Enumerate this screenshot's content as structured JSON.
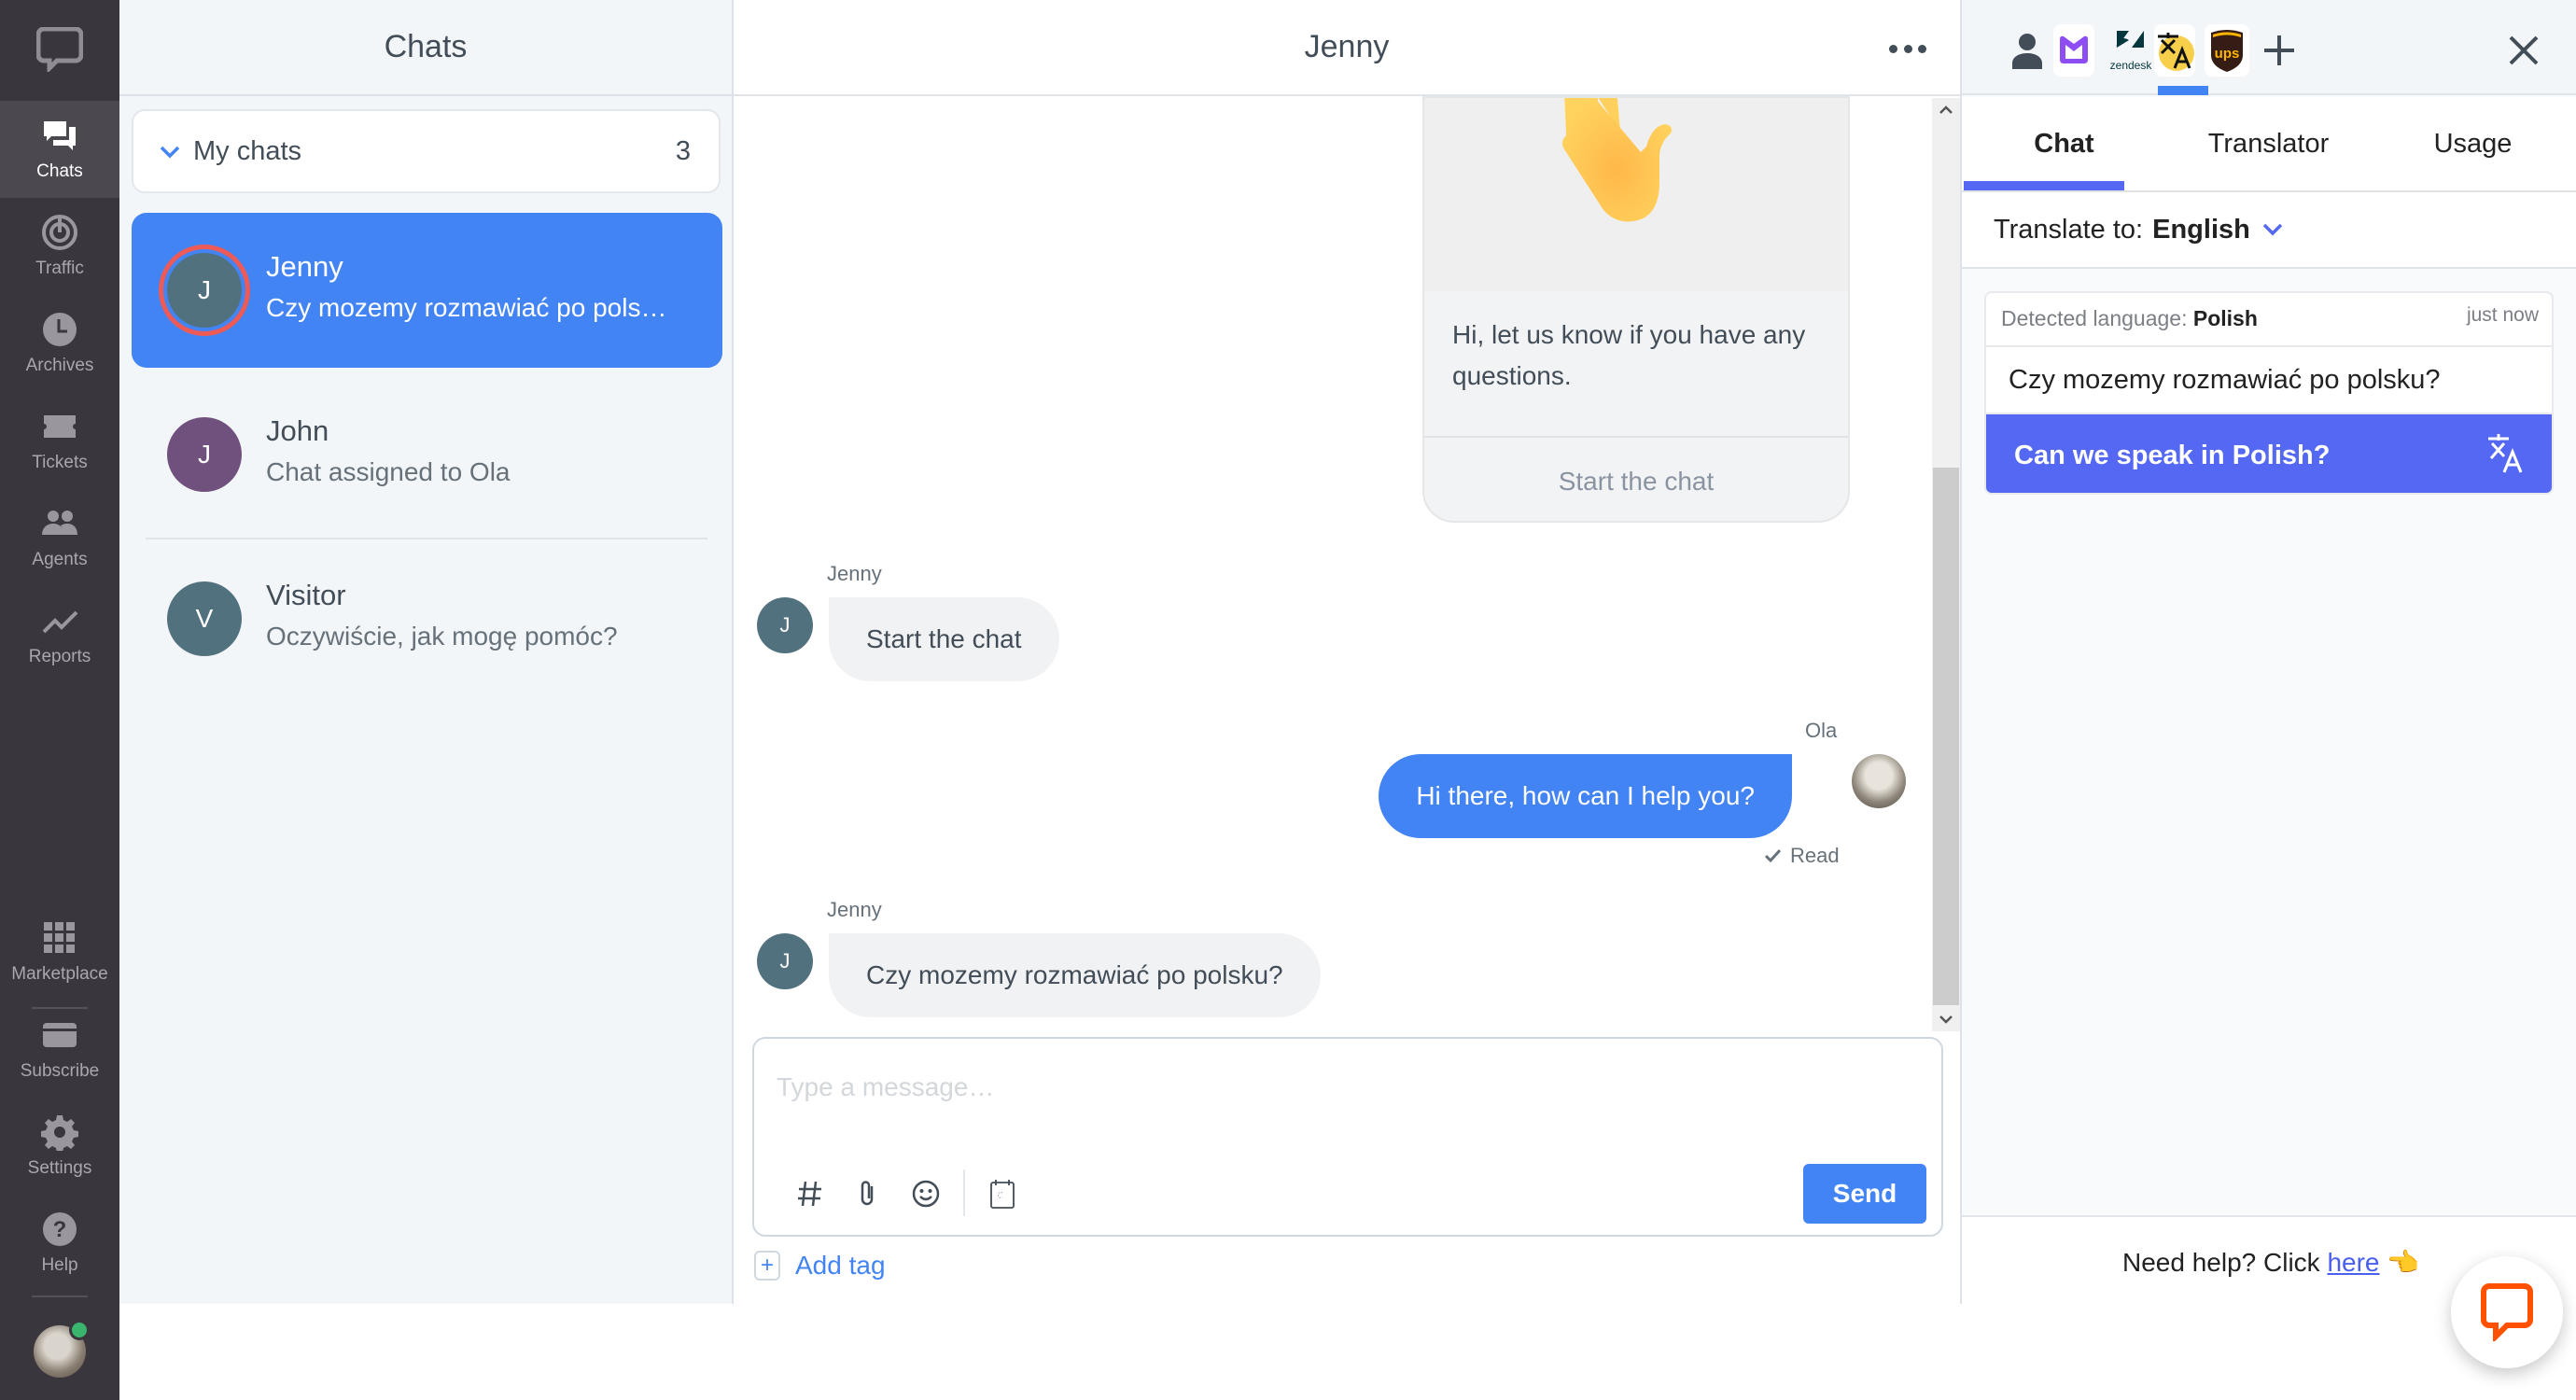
{
  "nav": {
    "logo_icon": "livechat-logo-icon",
    "items": [
      {
        "label": "Chats",
        "icon": "chats-icon",
        "active": true
      },
      {
        "label": "Traffic",
        "icon": "traffic-icon"
      },
      {
        "label": "Archives",
        "icon": "clock-icon"
      },
      {
        "label": "Tickets",
        "icon": "ticket-icon"
      },
      {
        "label": "Agents",
        "icon": "agents-icon"
      },
      {
        "label": "Reports",
        "icon": "chart-line-icon"
      }
    ],
    "bottom_items": [
      {
        "label": "Marketplace",
        "icon": "grid-icon"
      },
      {
        "label": "Subscribe",
        "icon": "credit-card-icon"
      },
      {
        "label": "Settings",
        "icon": "gear-icon"
      },
      {
        "label": "Help",
        "icon": "help-icon"
      }
    ],
    "status_color": "#3ab56e"
  },
  "chats": {
    "title": "Chats",
    "group": {
      "label": "My chats",
      "count": "3"
    },
    "items": [
      {
        "initial": "J",
        "name": "Jenny",
        "preview": "Czy mozemy rozmawiać po polsku?",
        "avatar_color": "#52717e",
        "active": true
      },
      {
        "initial": "J",
        "name": "John",
        "preview": "Chat assigned to Ola",
        "avatar_color": "#70507c"
      },
      {
        "initial": "V",
        "name": "Visitor",
        "preview": "Oczywiście, jak mogę pomóc?",
        "avatar_color": "#52717e"
      }
    ]
  },
  "conversation": {
    "title": "Jenny",
    "greeting_card": {
      "emoji": "👋",
      "text": "Hi, let us know if you have any questions.",
      "button": "Start the chat"
    },
    "messages": [
      {
        "author": "Jenny",
        "initial": "J",
        "text": "Start the chat",
        "direction": "in"
      },
      {
        "author": "Ola",
        "text": "Hi there, how can I help you?",
        "direction": "out",
        "status": "Read"
      },
      {
        "author": "Jenny",
        "initial": "J",
        "text": "Czy mozemy rozmawiać po polsku?",
        "direction": "in"
      }
    ],
    "composer": {
      "placeholder": "Type a message…",
      "value": "",
      "send_label": "Send",
      "add_tag_label": "Add tag"
    }
  },
  "right_panel": {
    "apps": [
      "customer-details-icon",
      "kb-app-icon",
      "zendesk-icon",
      "translator-app-icon",
      "ups-icon",
      "add-app-icon"
    ],
    "zendesk_label": "zendesk",
    "tabs": [
      {
        "label": "Chat",
        "active": true
      },
      {
        "label": "Translator"
      },
      {
        "label": "Usage"
      }
    ],
    "translate_to_label": "Translate to:",
    "translate_to_value": "English",
    "translation": {
      "detected_label": "Detected language:",
      "detected_value": "Polish",
      "time": "just now",
      "original": "Czy mozemy rozmawiać po polsku?",
      "translated": "Can we speak in Polish?"
    },
    "help": {
      "prefix": "Need help? Click",
      "link": "here",
      "emoji": "👈"
    }
  },
  "colors": {
    "accent": "#4384f5",
    "translator_accent": "#5468f3",
    "nav_bg": "#3a363d",
    "livechat_orange": "#ff5100"
  }
}
